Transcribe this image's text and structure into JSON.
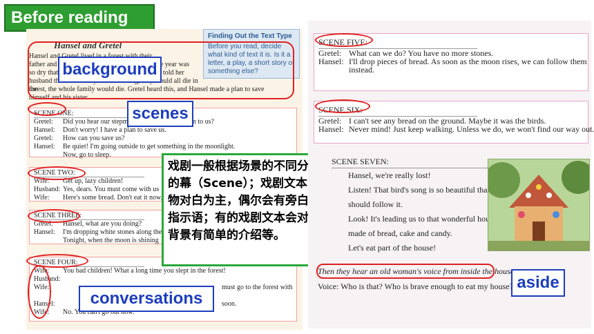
{
  "title": "Before reading",
  "book_title": "Hansel and Gretel",
  "background_text": [
    "Hansel and Gretel lived in a forest with their",
    "father and stepmother. The family was poor. The year was",
    "so dry that there was not enough food. The wife told her",
    "husband that unless they did something, they would all die in the",
    "forest, the whole family would die. Gretel heard this, and Hansel made a plan to save",
    "himself and his sister."
  ],
  "sidebar": {
    "heading": "Finding Out the Text Type",
    "body": "Before you read, decide what kind of text it is. Is it a letter, a play, a short story or something else?"
  },
  "scenes_left": [
    {
      "label": "SCENE ONE:",
      "lines": [
        {
          "speaker": "Gretel:",
          "text": "Did you hear our stepmother? What will happen to us?"
        },
        {
          "speaker": "Hansel:",
          "text": "Don't worry! I have a plan to save us."
        },
        {
          "speaker": "Gretel:",
          "text": "How can you save us?"
        },
        {
          "speaker": "Hansel:",
          "text": "Be quiet! I'm going outside to get something in the moonlight."
        },
        {
          "speaker": "",
          "text": "Now, go to sleep."
        }
      ]
    },
    {
      "label": "SCENE TWO:",
      "lines": [
        {
          "speaker": "Wife:",
          "text": "Get up, lazy children!"
        },
        {
          "speaker": "Husband:",
          "text": "Yes, dears. You must come with us"
        },
        {
          "speaker": "Wife:",
          "text": "Here's some bread. Don't eat it now."
        }
      ]
    },
    {
      "label": "SCENE THREE:",
      "lines": [
        {
          "speaker": "Gretel:",
          "text": "Hansel, what are you doing?"
        },
        {
          "speaker": "Hansel:",
          "text": "I'm dropping white stones along the way."
        },
        {
          "speaker": "",
          "text": "Tonight, when the moon is shining"
        }
      ]
    },
    {
      "label": "SCENE FOUR:",
      "lines": [
        {
          "speaker": "Wife:",
          "text": "You bad children! What a long time you slept in the forest!"
        },
        {
          "speaker": "Husband:",
          "text": ""
        },
        {
          "speaker": "Wife:",
          "text": "must go to the forest with"
        },
        {
          "speaker": "",
          "text": ""
        },
        {
          "speaker": "Hansel:",
          "text": "soon."
        },
        {
          "speaker": "Wife:",
          "text": "No. You can't go out now."
        }
      ]
    }
  ],
  "labels": {
    "background": "background",
    "scenes": "scenes",
    "conversations": "conversations",
    "aside": "aside"
  },
  "note": "戏剧一般根据场景的不同分为不同的幕（Scene）；戏剧文本多以人物对白为主，偶尔会有旁白或舞台指示语；有的戏剧文本会对故事的背景有简单的介绍等。",
  "scenes_right": [
    {
      "label": "SCENE FIVE:",
      "lines": [
        {
          "speaker": "Gretel:",
          "text": "What can we do? You have no more stones."
        },
        {
          "speaker": "Hansel:",
          "text": "I'll drop pieces of bread. As soon as the moon rises, we can follow them"
        },
        {
          "speaker": "",
          "text": "instead."
        }
      ]
    },
    {
      "label": "SCENE SIX:",
      "lines": [
        {
          "speaker": "Gretel:",
          "text": "I can't see any bread on the ground. Maybe it was the birds."
        },
        {
          "speaker": "Hansel:",
          "text": "Never mind! Just keep walking. Unless we do, we won't find our way out."
        }
      ]
    },
    {
      "label": "SCENE SEVEN:",
      "lines": [
        {
          "speaker": "",
          "text": "Hansel, we're really lost!"
        },
        {
          "speaker": "",
          "text": "Listen! That bird's song is so beautiful that we"
        },
        {
          "speaker": "",
          "text": "should follow it."
        },
        {
          "speaker": "",
          "text": "Look! It's leading us to that wonderful house"
        },
        {
          "speaker": "",
          "text": "made of bread, cake and candy."
        },
        {
          "speaker": "",
          "text": "Let's eat part of the house!"
        }
      ]
    }
  ],
  "aside_text": "Then they hear an old woman's voice from inside the house.",
  "voice_line": "Voice: Who is that? Who is brave enough to eat my house?"
}
